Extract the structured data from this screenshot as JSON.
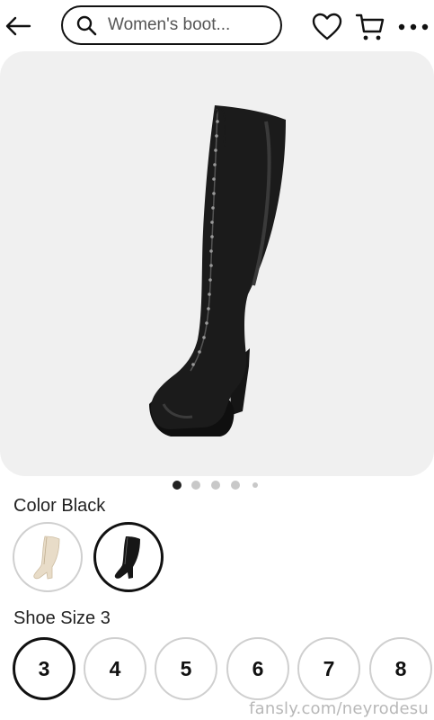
{
  "search": {
    "value": "Women's boot..."
  },
  "icons": {
    "back": "back-arrow-icon",
    "search": "search-icon",
    "wishlist": "heart-icon",
    "cart": "cart-icon",
    "more": "more-options-icon"
  },
  "gallery": {
    "total_images": 5,
    "current_index": 1
  },
  "color": {
    "label": "Color Black",
    "options": [
      {
        "name": "Beige",
        "selected": false
      },
      {
        "name": "Black",
        "selected": true
      }
    ]
  },
  "size": {
    "label": "Shoe Size 3",
    "options": [
      "3",
      "4",
      "5",
      "6",
      "7",
      "8"
    ],
    "selected": "3"
  },
  "watermark": "fansly.com/neyrodesu"
}
